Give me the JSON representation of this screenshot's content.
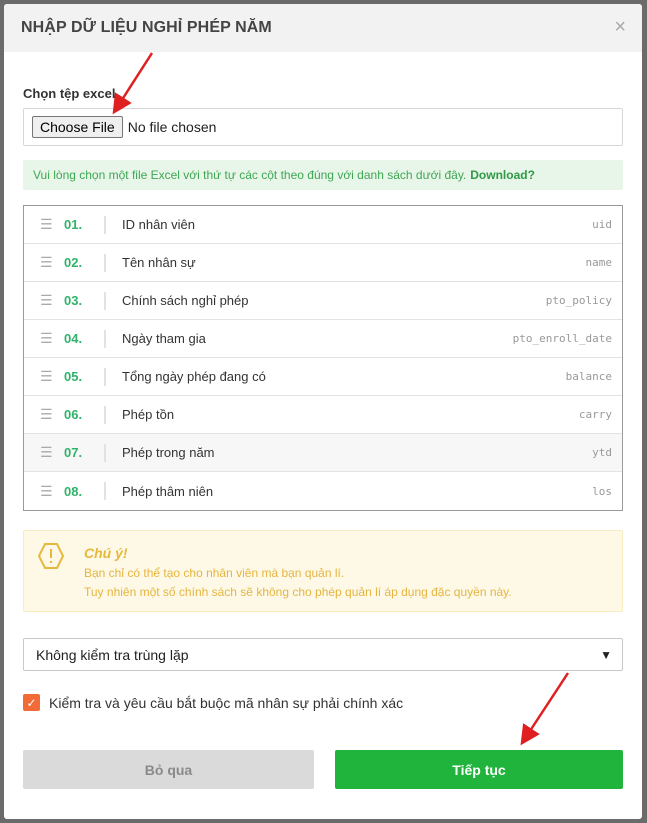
{
  "dialog": {
    "title": "NHẬP DỮ LIỆU NGHỈ PHÉP NĂM",
    "close_glyph": "×"
  },
  "file": {
    "label": "Chọn tệp excel",
    "button": "Choose File",
    "status": "No file chosen"
  },
  "hint": {
    "text": "Vui lòng chọn một file Excel với thứ tự các cột theo đúng với danh sách dưới đây.",
    "link": "Download?"
  },
  "columns": [
    {
      "num": "01.",
      "name": "ID nhân viên",
      "key": "uid"
    },
    {
      "num": "02.",
      "name": "Tên nhân sự",
      "key": "name"
    },
    {
      "num": "03.",
      "name": "Chính sách nghỉ phép",
      "key": "pto_policy"
    },
    {
      "num": "04.",
      "name": "Ngày tham gia",
      "key": "pto_enroll_date"
    },
    {
      "num": "05.",
      "name": "Tổng ngày phép đang có",
      "key": "balance"
    },
    {
      "num": "06.",
      "name": "Phép tồn",
      "key": "carry"
    },
    {
      "num": "07.",
      "name": "Phép trong năm",
      "key": "ytd"
    },
    {
      "num": "08.",
      "name": "Phép thâm niên",
      "key": "los"
    }
  ],
  "warning": {
    "title": "Chú ý!",
    "line1": "Bạn chỉ có thể tạo cho nhân viên mà bạn quản lí.",
    "line2": "Tuy nhiên một số chính sách sẽ không cho phép quản lí áp dụng đặc quyền này."
  },
  "duplicate_select": {
    "selected": "Không kiểm tra trùng lặp"
  },
  "strict_check": {
    "label": "Kiểm tra và yêu cầu bắt buộc mã nhân sự phải chính xác",
    "checked": true
  },
  "buttons": {
    "cancel": "Bỏ qua",
    "next": "Tiếp tục"
  },
  "colors": {
    "accent_green": "#21b43c",
    "number_green": "#2fb36a",
    "warning_yellow": "#e6b83c",
    "checkbox_orange": "#f26a35",
    "annotation_red": "#e02020"
  }
}
